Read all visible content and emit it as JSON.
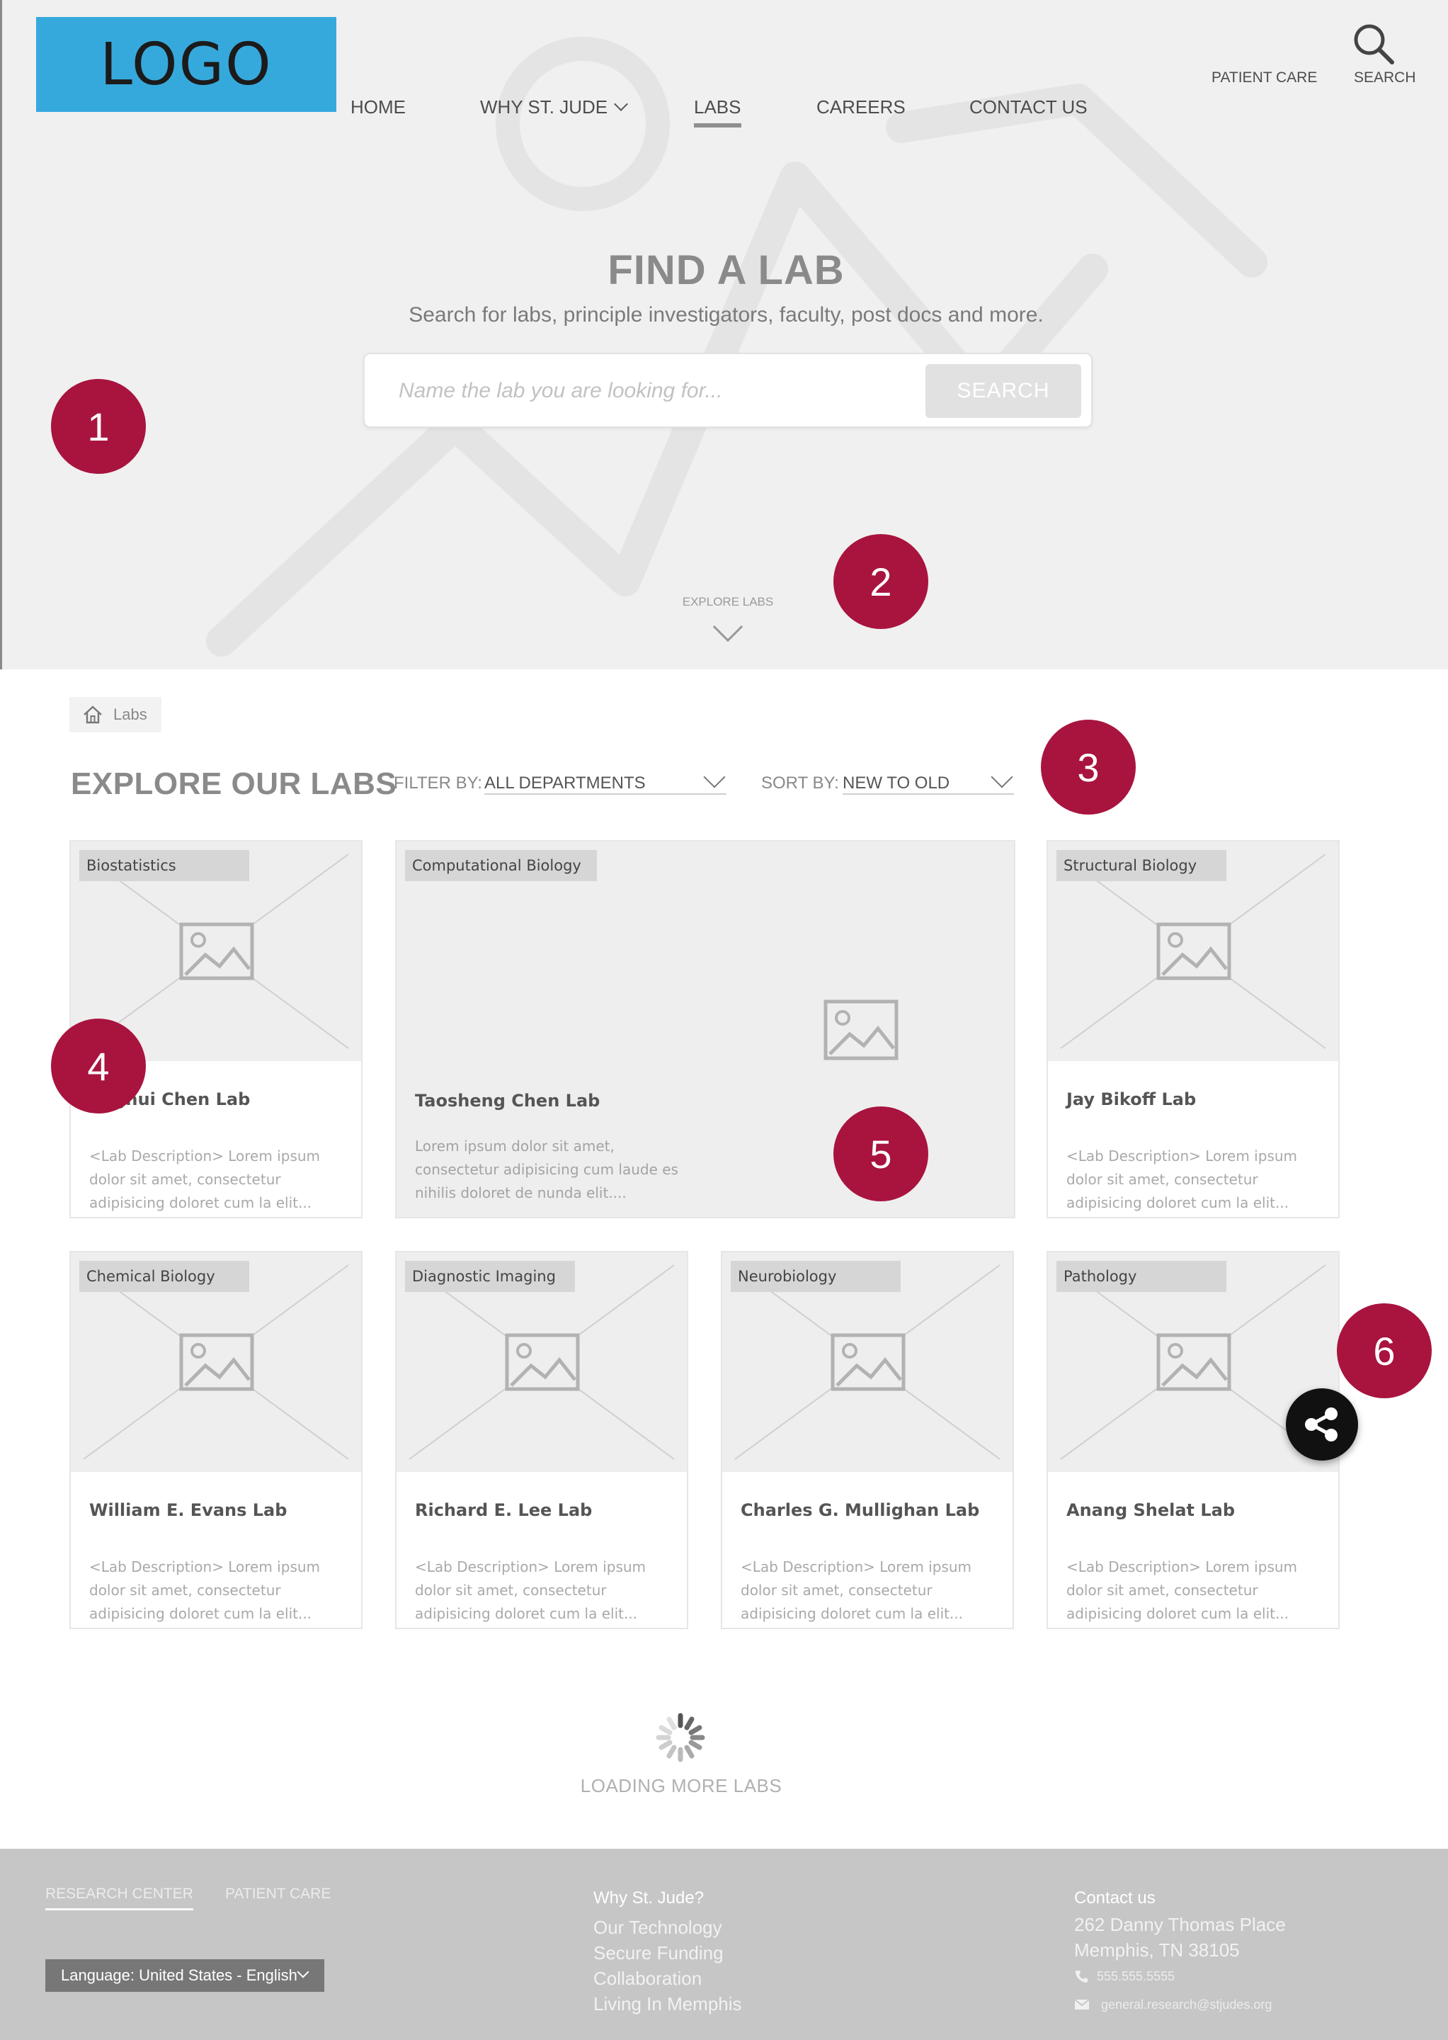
{
  "logo": {
    "text": "LOGO",
    "color": "#36a9dc"
  },
  "nav": {
    "items": [
      {
        "label": "HOME"
      },
      {
        "label": "WHY ST. JUDE"
      },
      {
        "label": "LABS",
        "active": true
      },
      {
        "label": "CAREERS"
      },
      {
        "label": "CONTACT US"
      }
    ],
    "patient_care": "PATIENT CARE",
    "search": {
      "label": "SEARCH",
      "icon": "search-icon"
    }
  },
  "hero": {
    "title": "FIND A LAB",
    "subtitle": "Search for labs, principle investigators, faculty, post docs and more.",
    "search_placeholder": "Name the lab you are looking for...",
    "search_value": "",
    "search_button": "SEARCH",
    "explore_label": "EXPLORE LABS"
  },
  "annotations": [
    "1",
    "2",
    "3",
    "4",
    "5",
    "6"
  ],
  "annotation_color": "#a8143e",
  "breadcrumb": {
    "icon": "home-icon",
    "label": "Labs"
  },
  "labs_section": {
    "title": "EXPLORE OUR LABS",
    "filter_label": "FILTER BY:",
    "filter_value": "ALL DEPARTMENTS",
    "sort_label": "SORT BY:",
    "sort_value": "NEW TO OLD"
  },
  "cards": [
    {
      "category": "Biostatistics",
      "title": "Jinghui Chen Lab",
      "description": "<Lab Description> Lorem ipsum dolor sit amet, consectetur adipisicing doloret cum la elit..."
    },
    {
      "category": "Computational Biology",
      "title": "Taosheng Chen Lab",
      "description": "Lorem ipsum dolor sit amet, consectetur adipisicing cum laude es nihilis doloret de nunda  elit....",
      "featured": true
    },
    {
      "category": "Structural Biology",
      "title": "Jay Bikoff Lab",
      "description": "<Lab Description> Lorem ipsum dolor sit amet, consectetur adipisicing doloret cum la elit..."
    },
    {
      "category": "Chemical Biology",
      "title": "William E. Evans Lab",
      "description": "<Lab Description> Lorem ipsum dolor sit amet, consectetur adipisicing doloret cum la elit..."
    },
    {
      "category": "Diagnostic Imaging",
      "title": "Richard E. Lee Lab",
      "description": "<Lab Description> Lorem ipsum dolor sit amet, consectetur adipisicing doloret cum la elit..."
    },
    {
      "category": "Neurobiology",
      "title": "Charles G. Mullighan Lab",
      "description": "<Lab Description> Lorem ipsum dolor sit amet, consectetur adipisicing doloret cum la elit..."
    },
    {
      "category": "Pathology",
      "title": "Anang Shelat Lab",
      "description": "<Lab Description> Lorem ipsum dolor sit amet, consectetur adipisicing doloret cum la elit..."
    }
  ],
  "share_button": {
    "icon": "share-icon"
  },
  "loading": {
    "label": "LOADING MORE LABS",
    "icon": "spinner-icon"
  },
  "footer": {
    "tabs": [
      {
        "label": "RESEARCH CENTER",
        "active": true
      },
      {
        "label": "PATIENT CARE"
      }
    ],
    "language": "Language: United States - English",
    "why_heading": "Why St. Jude?",
    "why_links": [
      "Our Technology",
      "Secure Funding",
      "Collaboration",
      "Living In Memphis"
    ],
    "contact_heading": "Contact us",
    "address_line1": "262 Danny Thomas Place",
    "address_line2": "Memphis, TN 38105",
    "phone": "555.555.5555",
    "email": "general.research@stjudes.org"
  }
}
